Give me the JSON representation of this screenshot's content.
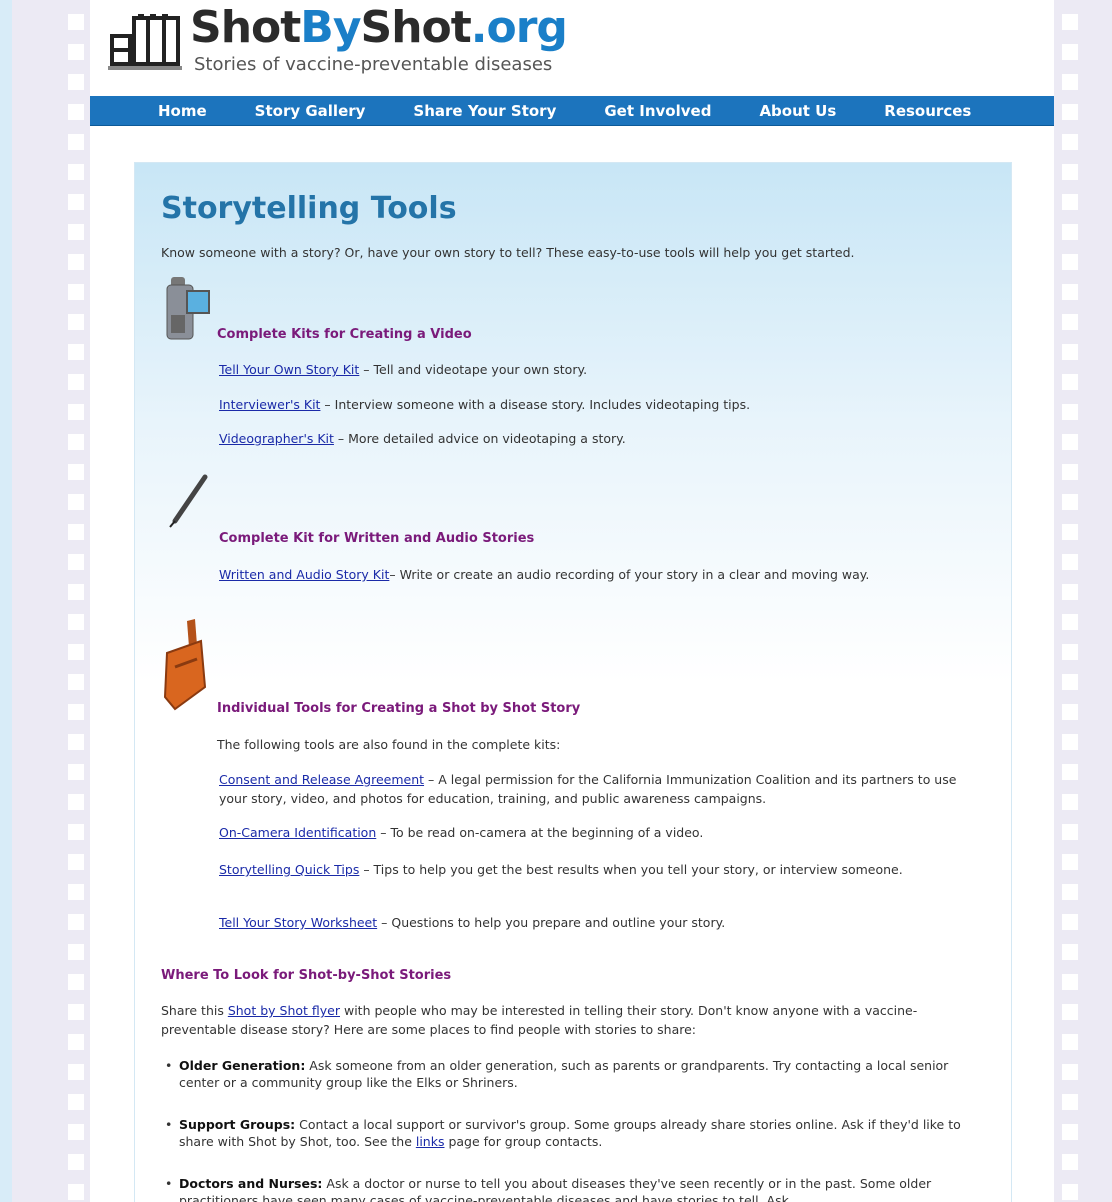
{
  "logo": {
    "title_shot": "Shot",
    "title_by": "By",
    "title_shot2": "Shot",
    "title_org": ".org",
    "tagline": "Stories of vaccine-preventable diseases"
  },
  "nav": [
    "Home",
    "Story Gallery",
    "Share Your Story",
    "Get Involved",
    "About Us",
    "Resources"
  ],
  "main": {
    "title": "Storytelling Tools",
    "intro": "Know someone with a story? Or, have your own story to tell? These easy-to-use tools will help you get started."
  },
  "sections": {
    "video": {
      "heading": "Complete Kits for Creating a Video",
      "items": [
        {
          "link": "Tell Your Own Story Kit",
          "desc": " – Tell and videotape your own story."
        },
        {
          "link": "Interviewer's Kit",
          "desc": " – Interview someone with a disease story. Includes videotaping tips."
        },
        {
          "link": "Videographer's Kit",
          "desc": " – More detailed advice on videotaping a story."
        }
      ]
    },
    "written": {
      "heading": "Complete Kit for Written and Audio Stories",
      "items": [
        {
          "link": "Written and Audio Story Kit",
          "desc": "– Write or create an audio recording of your story in a clear and moving way."
        }
      ]
    },
    "individual": {
      "heading": "Individual Tools for Creating a Shot by Shot Story",
      "note": "The following tools are also found in the complete kits:",
      "items": [
        {
          "link": "Consent and Release Agreement",
          "desc": " – A legal permission for the California Immunization Coalition and its partners to use your story, video, and photos for education, training, and public awareness campaigns."
        },
        {
          "link": "On-Camera Identification",
          "desc": " – To be read on-camera at the beginning of a video."
        },
        {
          "link": "Storytelling Quick Tips",
          "desc": " – Tips to help you get the best results when you tell your story, or interview someone."
        },
        {
          "link": "Tell Your Story Worksheet",
          "desc": " – Questions to help you prepare and outline your story."
        }
      ]
    }
  },
  "where": {
    "heading": "Where To Look for Shot-by-Shot Stories",
    "text_before": "Share this ",
    "link": "Shot by Shot flyer",
    "text_after": " with people who may be interested in telling their story.  Don't know anyone with a vaccine-preventable disease story? Here are some places to find people with stories to share:",
    "bullets": [
      {
        "term": "Older Generation:",
        "text": " Ask someone from an older generation, such as parents or grandparents. Try contacting a local senior center or a community group like the Elks or Shriners."
      },
      {
        "term": "Support Groups:",
        "text_before": " Contact a local support or survivor's group. Some groups already share stories online. Ask if they'd like to share with Shot by Shot, too. See the ",
        "link": "links",
        "text_after": " page for group contacts."
      },
      {
        "term": "Doctors and Nurses:",
        "text": " Ask a doctor or nurse to tell you about diseases they've seen recently or in the past. Some older practitioners have seen many cases of vaccine-preventable diseases and have stories to tell. Ask"
      }
    ]
  },
  "icons": [
    "film-reel-icon",
    "video-camera-icon",
    "pen-icon",
    "toolbox-icon"
  ]
}
